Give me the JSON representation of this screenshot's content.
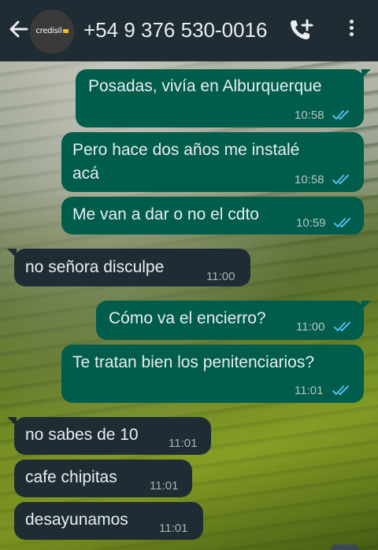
{
  "header": {
    "contact": "+54 9 376 530-0016",
    "avatar_brand": "credisil"
  },
  "colors": {
    "header_bg": "#1f2c34",
    "outgoing_bubble": "#005c4b",
    "incoming_bubble": "#1f2c34",
    "read_tick": "#53bdeb",
    "brand_mark": "#f2c018"
  },
  "messages": [
    {
      "direction": "out",
      "lines": [
        "Posadas, vivía en Alburquerque"
      ],
      "time": "10:58",
      "status": "read"
    },
    {
      "direction": "out",
      "lines": [
        "Pero hace dos años me instalé",
        "acá"
      ],
      "time": "10:58",
      "status": "read"
    },
    {
      "direction": "out",
      "lines": [
        "Me van a dar o no el cdto"
      ],
      "time": "10:59",
      "status": "read"
    },
    {
      "direction": "in",
      "lines": [
        "no señora  disculpe"
      ],
      "time": "11:00"
    },
    {
      "direction": "out",
      "lines": [
        "Cómo va el encierro?"
      ],
      "time": "11:00",
      "status": "read"
    },
    {
      "direction": "out",
      "lines": [
        "Te tratan bien los penitenciarios?"
      ],
      "time": "11:01",
      "status": "read"
    },
    {
      "direction": "in",
      "lines": [
        "no sabes de 10"
      ],
      "time": "11:01"
    },
    {
      "direction": "in",
      "lines": [
        "cafe chipitas"
      ],
      "time": "11:01"
    },
    {
      "direction": "in",
      "lines": [
        "desayunamos"
      ],
      "time": "11:01"
    }
  ]
}
